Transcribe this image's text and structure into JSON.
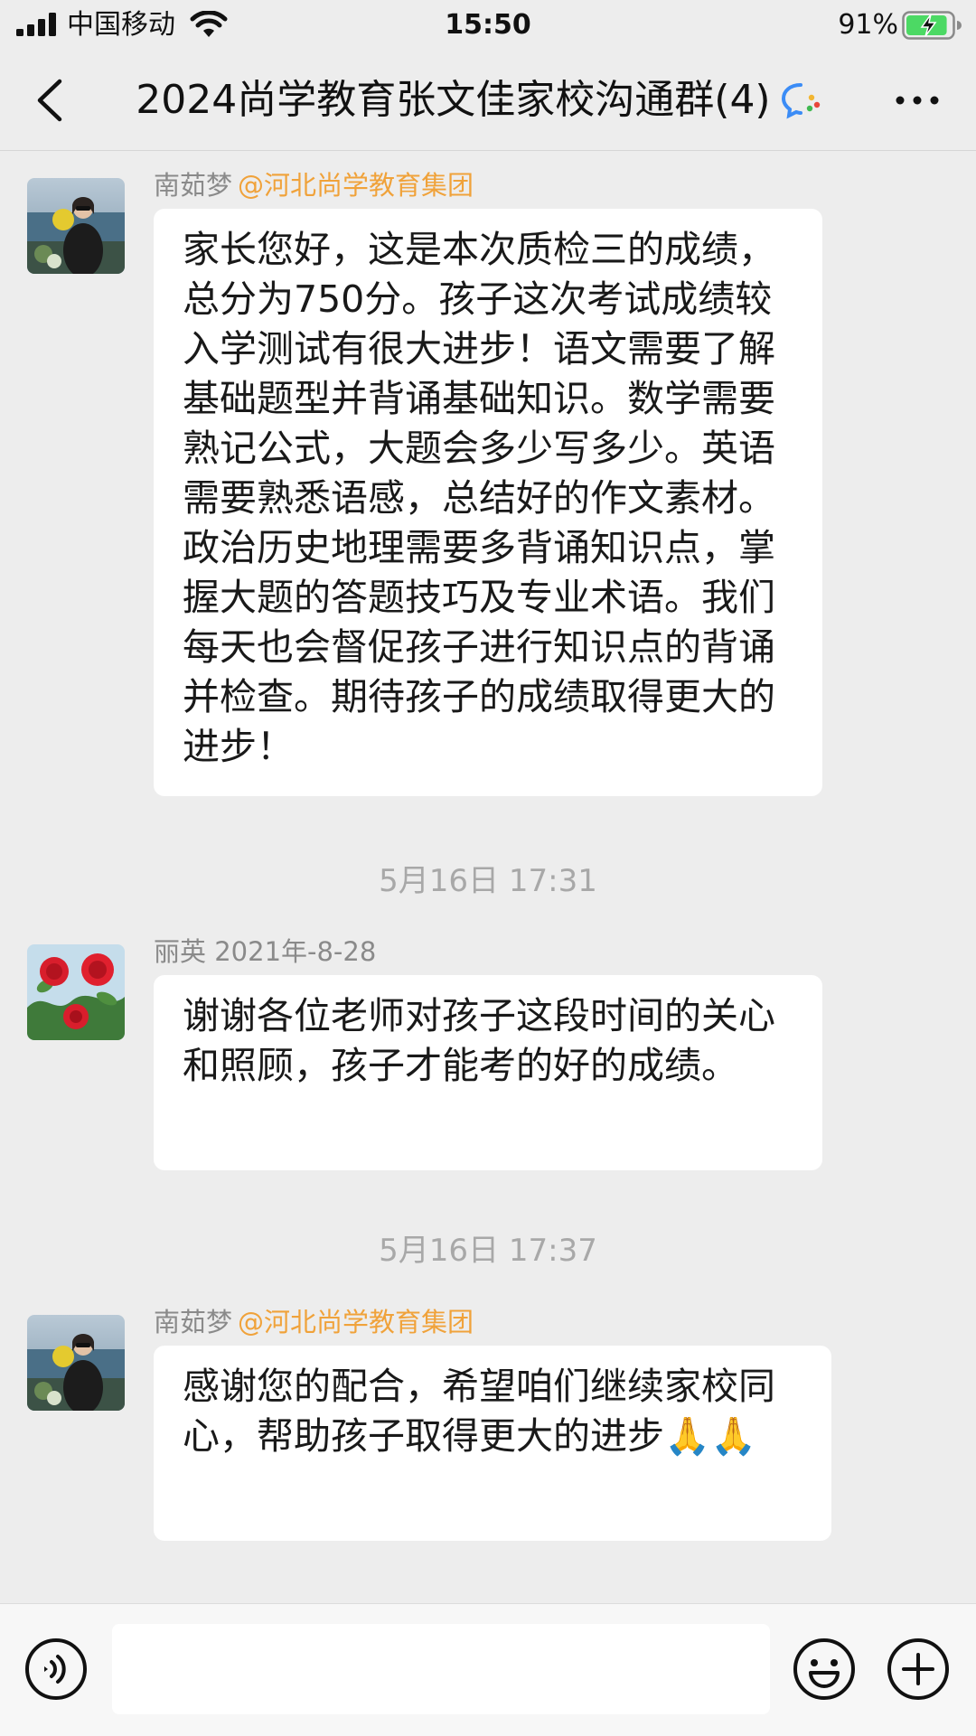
{
  "status_bar": {
    "carrier": "中国移动",
    "time": "15:50",
    "battery_percent": "91%",
    "battery_level": 0.91,
    "icons": [
      "signal-icon",
      "wifi-icon",
      "battery-charging-icon"
    ]
  },
  "nav": {
    "title": "2024尚学教育张文佳家校沟通群(4)",
    "icons": [
      "back-chevron-icon",
      "chat-bubble-icon",
      "more-dots-icon"
    ]
  },
  "messages": [
    {
      "sender": "南茹梦",
      "mention": "@河北尚学教育集团",
      "avatar": "seaside-portrait-avatar",
      "text": "家长您好，这是本次质检三的成绩，总分为750分。孩子这次考试成绩较入学测试有很大进步！语文需要了解基础题型并背诵基础知识。数学需要熟记公式，大题会多少写多少。英语需要熟悉语感，总结好的作文素材。政治历史地理需要多背诵知识点，掌握大题的答题技巧及专业术语。我们每天也会督促孩子进行知识点的背诵并检查。期待孩子的成绩取得更大的进步！"
    },
    {
      "sender": "丽英 2021年-8-28",
      "mention": "",
      "avatar": "red-roses-avatar",
      "text": "谢谢各位老师对孩子这段时间的关心和照顾，孩子才能考的好的成绩。"
    },
    {
      "sender": "南茹梦",
      "mention": "@河北尚学教育集团",
      "avatar": "seaside-portrait-avatar",
      "text": "感谢您的配合，希望咱们继续家校同心，帮助孩子取得更大的进步🙏🙏"
    }
  ],
  "timestamps": [
    "5月16日 17:31",
    "5月16日 17:37"
  ],
  "input_bar": {
    "placeholder": "",
    "icons": [
      "voice-icon",
      "emoji-icon",
      "plus-icon"
    ]
  },
  "colors": {
    "background": "#ededed",
    "bubble": "#ffffff",
    "mention": "#f0a23a",
    "timestamp": "#a8a8a8",
    "sender": "#8a8a8a",
    "battery_green": "#4cd964",
    "chat_icon_blue": "#3b8cf6"
  }
}
